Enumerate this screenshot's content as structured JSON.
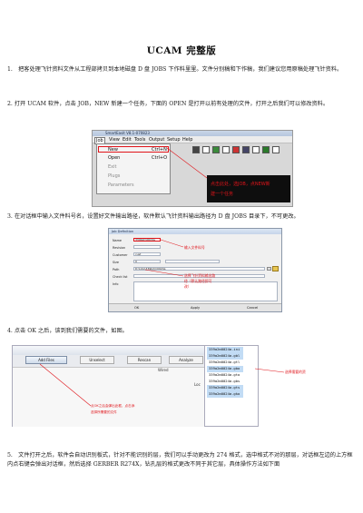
{
  "doc": {
    "title": "UCAM 完整版",
    "p1": "1.　把客处理飞针资料文件从工程部拷贝到本地磁盘 D 盘 JOBS 下作料里里。文件分别稿和下作稿，我们建议您用原稿处理飞针资料。",
    "p2": "2. 打开 UCAM 软件，点击 JOB，NEW 新建一个任务，下面的 OPEN 是打开以前有处理的文件，打开之后我们可以修改资料。",
    "p3": "3. 在对话框中输入文件料号名，设置好文件输出路径，软件默认飞针资料输出路径为 D 盘 JOBS 目录下，不可更改。",
    "p4": "4. 点击 OK 之后，该到我们需要的文件，如图。",
    "p5": "5.　文件打开之后，软件会自动识别板式，针对不能识别的层，我们可以手动更改为 274 格式，选中格式不对的那层，对话框左边的上方框内点右键会弹出对话框，然后选择 GERBER R274X，钻孔层的格式更改不同于其它层，具体操作方法如下面"
  },
  "shot1": {
    "window_title": "SmartEasit V8.1-070823",
    "menu": [
      "Job",
      "View",
      "Edit",
      "Tools",
      "Output",
      "Setup",
      "Help"
    ],
    "dropdown": [
      {
        "label": "New",
        "shortcut": "Ctrl+N"
      },
      {
        "label": "Open",
        "shortcut": "Ctrl+O"
      },
      {
        "label": "Exit",
        "shortcut": ""
      },
      {
        "label": "Plugs",
        "shortcut": ""
      },
      {
        "label": "Parameters",
        "shortcut": ""
      }
    ],
    "annotation_line1": "点击此处，选JOB，点NEW新",
    "annotation_line2": "建一个任务"
  },
  "shot2": {
    "window_title": "Job Definition",
    "labels": [
      "Name",
      "Revision",
      "Customer",
      "Size",
      "Path",
      "Check list",
      "Info"
    ],
    "values": {
      "name": "339b2m0024a",
      "revision": "",
      "customer": "cust",
      "size": "0",
      "path": "D:\\Jobs\\339b2m0024a",
      "check_list": ""
    },
    "annotation_name": "输入文件料号",
    "annotation_path_line1": "选择飞针资料输出路",
    "annotation_path_line2": "径（默认路径即可",
    "annotation_path_line3": "改）",
    "buttons": [
      "OK",
      "Apply",
      "Cancel"
    ]
  },
  "shot3": {
    "buttons": [
      "Add Files",
      "Unselect",
      "Rescan",
      "Analyze"
    ],
    "side_text": "Wired",
    "side_text2": "Loc",
    "files": [
      "339a2m0024a.ini",
      "339a2m0024a.gbl",
      "339a2m0024a.gtl",
      "339a2m0024a.gbo",
      "339a2m0024a.gto",
      "339a2m0024a.gbs",
      "339a2m0024a.gts",
      "339a2m0024a.gko"
    ],
    "annotation_left_line1": "点OK之后会弹出此框，点击添",
    "annotation_left_line2": "选择所需要的文件",
    "annotation_right": "选择需要的资"
  }
}
